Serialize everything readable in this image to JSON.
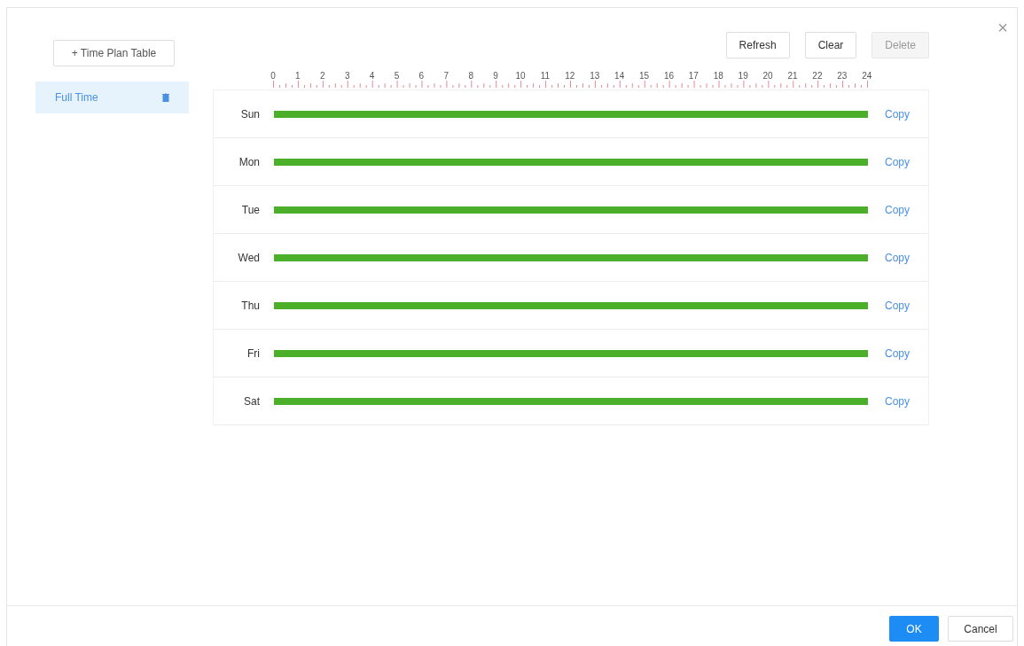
{
  "plan_button": {
    "label": "+ Time Plan Table"
  },
  "plans": [
    {
      "name": "Full Time",
      "selected": true
    }
  ],
  "toolbar": [
    {
      "label": "Refresh",
      "disabled": false
    },
    {
      "label": "Clear",
      "disabled": false
    },
    {
      "label": "Delete",
      "disabled": true
    }
  ],
  "close": "×",
  "hours": [
    "0",
    "1",
    "2",
    "3",
    "4",
    "5",
    "6",
    "7",
    "8",
    "9",
    "10",
    "11",
    "12",
    "13",
    "14",
    "15",
    "16",
    "17",
    "18",
    "19",
    "20",
    "21",
    "22",
    "23",
    "24"
  ],
  "days": [
    {
      "label": "Sun",
      "level": 1,
      "action": "Copy"
    },
    {
      "label": "Mon",
      "level": 1,
      "action": "Copy"
    },
    {
      "label": "Tue",
      "level": 1,
      "action": "Copy"
    },
    {
      "label": "Wed",
      "level": 1,
      "action": "Copy"
    },
    {
      "label": "Thu",
      "level": 1,
      "action": "Copy"
    },
    {
      "label": "Fri",
      "level": 1,
      "action": "Copy"
    },
    {
      "label": "Sat",
      "level": 1,
      "action": "Copy"
    }
  ],
  "footer": [
    {
      "label": "OK",
      "kind": "primary"
    },
    {
      "label": "Cancel",
      "kind": "default"
    }
  ]
}
